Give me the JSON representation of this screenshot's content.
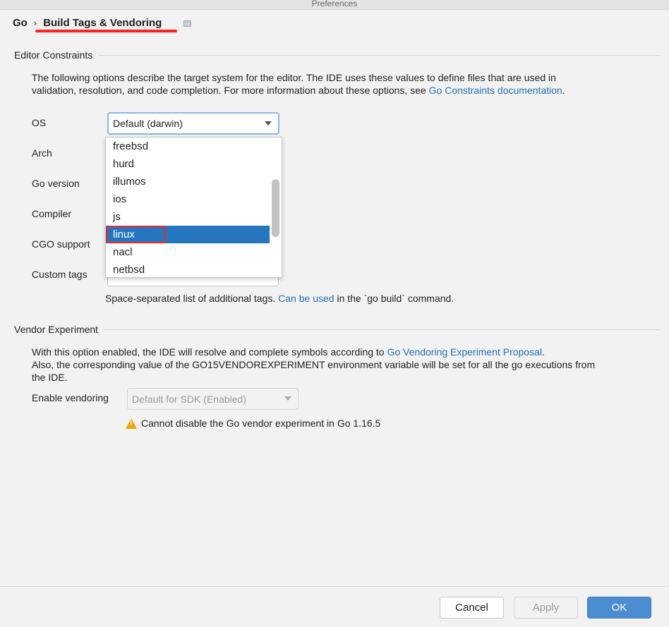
{
  "window": {
    "title": "Preferences"
  },
  "breadcrumb": {
    "parent": "Go",
    "separator": "›",
    "current": "Build Tags & Vendoring"
  },
  "editor_constraints": {
    "title": "Editor Constraints",
    "desc_line1": "The following options describe the target system for the editor. The IDE uses these values to define files that are used in",
    "desc_line2": "validation, resolution, and code completion. For more information about these options, see ",
    "desc_link": "Go Constraints documentation",
    "desc_end": ".",
    "labels": {
      "os": "OS",
      "arch": "Arch",
      "go_version": "Go version",
      "compiler": "Compiler",
      "cgo": "CGO support",
      "custom_tags": "Custom tags"
    },
    "os_value": "Default (darwin)",
    "os_options": [
      "freebsd",
      "hurd",
      "illumos",
      "ios",
      "js",
      "linux",
      "nacl",
      "netbsd"
    ],
    "os_highlighted": "linux",
    "hint_pre": "Space-separated list of additional tags. ",
    "hint_link": "Can be used",
    "hint_post": " in the `go build` command."
  },
  "vendor": {
    "title": "Vendor Experiment",
    "desc_line1": "With this option enabled, the IDE will resolve and complete symbols according to ",
    "desc_link": "Go Vendoring Experiment Proposal",
    "desc_end": ".",
    "desc_line2": "Also, the corresponding value of the GO15VENDOREXPERIMENT environment variable will be set for all the go executions from",
    "desc_line3": "the IDE.",
    "enable_label": "Enable vendoring",
    "enable_value": "Default for SDK (Enabled)",
    "warning": "Cannot disable the Go vendor experiment in Go 1.16.5",
    "warning_icon": "warning-triangle-icon"
  },
  "footer": {
    "cancel": "Cancel",
    "apply": "Apply",
    "ok": "OK"
  },
  "colors": {
    "accent": "#2675bf",
    "link": "#2470b3",
    "ok_button": "#4b8dd0",
    "annotation": "#ff2020",
    "warning": "#f0a30a"
  }
}
